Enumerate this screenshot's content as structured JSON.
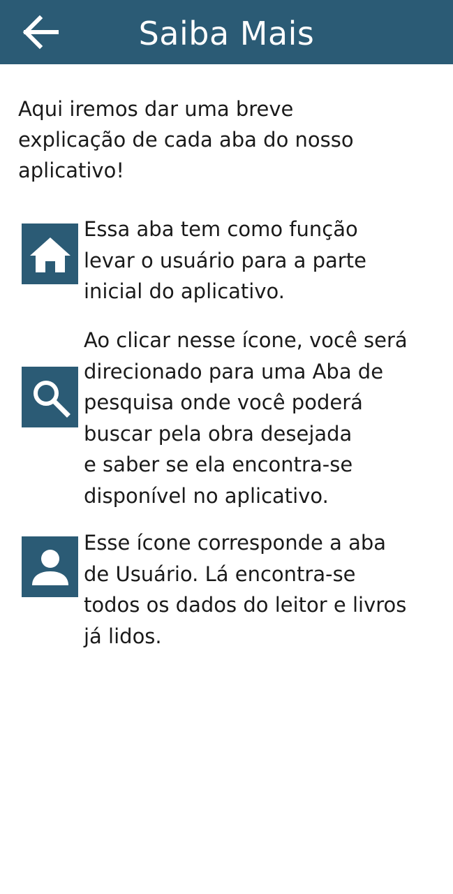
{
  "header": {
    "title": "Saiba Mais",
    "back_icon": "arrow-left-icon",
    "color": "#2b5b75"
  },
  "intro": "Aqui iremos dar uma breve\nexplicação de cada aba do nosso\naplicativo!",
  "items": [
    {
      "icon": "home-icon",
      "text": "Essa aba tem como função\nlevar o usuário para a parte\ninicial do aplicativo."
    },
    {
      "icon": "search-icon",
      "text": "Ao clicar nesse ícone, você será\ndirecionado para uma Aba de\npesquisa onde você poderá\nbuscar pela obra desejada\ne saber se ela  encontra-se\ndisponível no aplicativo."
    },
    {
      "icon": "user-icon",
      "text": "Esse ícone corresponde a aba\nde  Usuário. Lá encontra-se\ntodos os dados do leitor e livros\njá lidos."
    }
  ]
}
